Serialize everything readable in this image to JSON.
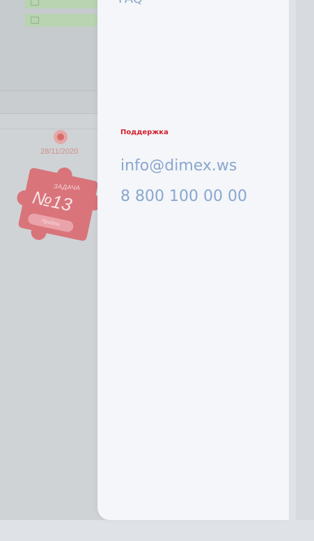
{
  "background": {
    "date": "28/11/2020",
    "task_badge": {
      "title": "ЗАДАЧА",
      "number": "№13",
      "button_label": "Пройти"
    }
  },
  "panel": {
    "top_partial_text": "FAQ",
    "support_label": "Поддержка",
    "email": "info@dimex.ws",
    "phone": "8 800 100 00 00"
  },
  "colors": {
    "accent_red": "#d4202f",
    "link_blue": "#8aa6cf",
    "panel_bg": "#f4f6f9"
  }
}
